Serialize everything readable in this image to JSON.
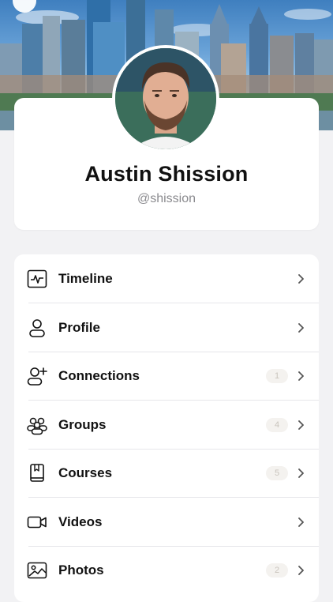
{
  "profile": {
    "name": "Austin Shission",
    "handle": "@shission"
  },
  "menu": {
    "items": [
      {
        "label": "Timeline",
        "icon": "pulse-icon"
      },
      {
        "label": "Profile",
        "icon": "user-icon"
      },
      {
        "label": "Connections",
        "icon": "user-plus-icon",
        "badge": "1"
      },
      {
        "label": "Groups",
        "icon": "users-icon",
        "badge": "4"
      },
      {
        "label": "Courses",
        "icon": "book-icon",
        "badge": "5"
      },
      {
        "label": "Videos",
        "icon": "video-icon"
      },
      {
        "label": "Photos",
        "icon": "photo-icon",
        "badge": "2"
      }
    ]
  },
  "colors": {
    "background": "#f2f2f4",
    "card": "#ffffff",
    "text": "#111111",
    "muted": "#8a8a8e",
    "badge_bg": "#f4f2ef",
    "badge_text": "#c9c4bd"
  }
}
